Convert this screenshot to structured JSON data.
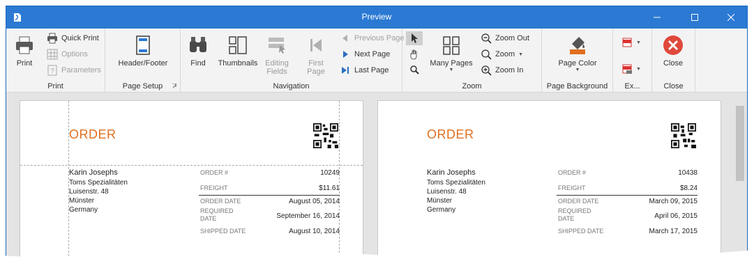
{
  "window": {
    "title": "Preview"
  },
  "ribbon": {
    "print": {
      "print_label": "Print",
      "quick_print_label": "Quick Print",
      "options_label": "Options",
      "parameters_label": "Parameters",
      "group_label": "Print"
    },
    "page_setup": {
      "header_footer_label": "Header/Footer",
      "group_label": "Page Setup"
    },
    "navigation": {
      "find_label": "Find",
      "thumbnails_label": "Thumbnails",
      "editing_fields_line1": "Editing",
      "editing_fields_line2": "Fields",
      "first_page_line1": "First",
      "first_page_line2": "Page",
      "previous_page_label": "Previous Page",
      "next_page_label": "Next Page",
      "last_page_label": "Last Page",
      "group_label": "Navigation"
    },
    "zoom": {
      "many_pages_label": "Many Pages",
      "zoom_out_label": "Zoom Out",
      "zoom_label": "Zoom",
      "zoom_in_label": "Zoom In",
      "group_label": "Zoom"
    },
    "page_background": {
      "page_color_label": "Page Color",
      "group_label": "Page Background"
    },
    "export": {
      "group_label": "Ex..."
    },
    "close": {
      "close_label": "Close",
      "group_label": "Close"
    }
  },
  "pages": [
    {
      "title": "ORDER",
      "customer": {
        "name": "Karin Josephs",
        "company": "Toms Spezialitäten",
        "street": "Luisenstr. 48",
        "city": "Münster",
        "country": "Germany"
      },
      "order_no_label": "ORDER #",
      "order_no": "10249",
      "freight_label": "FREIGHT",
      "freight": "$11.61",
      "order_date_label": "ORDER DATE",
      "order_date": "August 05, 2014",
      "required_label_1": "REQUIRED",
      "required_label_2": "DATE",
      "required_date": "September 16, 2014",
      "shipped_label": "SHIPPED DATE",
      "shipped_date": "August 10, 2014"
    },
    {
      "title": "ORDER",
      "customer": {
        "name": "Karin Josephs",
        "company": "Toms Spezialitäten",
        "street": "Luisenstr. 48",
        "city": "Münster",
        "country": "Germany"
      },
      "order_no_label": "ORDER #",
      "order_no": "10438",
      "freight_label": "FREIGHT",
      "freight": "$8.24",
      "order_date_label": "ORDER DATE",
      "order_date": "March 09, 2015",
      "required_label_1": "REQUIRED",
      "required_label_2": "DATE",
      "required_date": "April 06, 2015",
      "shipped_label": "SHIPPED DATE",
      "shipped_date": "March 17, 2015"
    }
  ],
  "colors": {
    "titlebar": "#2b79d3",
    "accent_orange": "#e07020",
    "close_red": "#e0483c"
  }
}
